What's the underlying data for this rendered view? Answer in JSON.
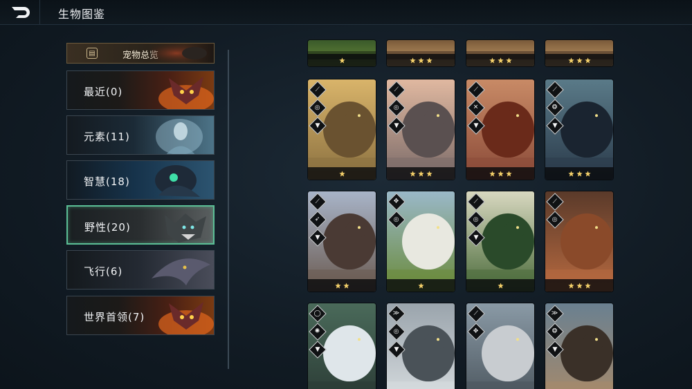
{
  "header": {
    "title": "生物图鉴",
    "back_icon": "back-arrow-icon"
  },
  "overview": {
    "label": "宠物总览",
    "icon": "book-icon"
  },
  "categories": [
    {
      "label": "最近(0)",
      "selected": false,
      "art": "fire-demon"
    },
    {
      "label": "元素(11)",
      "selected": false,
      "art": "ice-spirit"
    },
    {
      "label": "智慧(18)",
      "selected": false,
      "art": "goblin-mage"
    },
    {
      "label": "野性(20)",
      "selected": true,
      "art": "wolf-beast"
    },
    {
      "label": "飞行(6)",
      "selected": false,
      "art": "wyvern"
    },
    {
      "label": "世界首领(7)",
      "selected": false,
      "art": "fire-demon"
    }
  ],
  "colors": {
    "selected_border": "#5bbf96",
    "star": "#f4d06a",
    "badge_border": "#d6d8da"
  },
  "cards": [
    {
      "row": 0,
      "stars": 1,
      "partial": true,
      "creature": "forest-scene"
    },
    {
      "row": 0,
      "stars": 3,
      "partial": true,
      "creature": "desert-scene"
    },
    {
      "row": 0,
      "stars": 3,
      "partial": true,
      "creature": "desert-scene"
    },
    {
      "row": 0,
      "stars": 3,
      "partial": true,
      "creature": "desert-scene"
    },
    {
      "row": 1,
      "stars": 1,
      "creature": "golden-hyena",
      "badges": [
        "claw",
        "swirl",
        "fang"
      ]
    },
    {
      "row": 1,
      "stars": 3,
      "creature": "stone-dinosaur",
      "badges": [
        "claw",
        "swirl",
        "fang"
      ]
    },
    {
      "row": 1,
      "stars": 3,
      "creature": "lava-beast",
      "badges": [
        "claw",
        "hammer",
        "fang"
      ]
    },
    {
      "row": 1,
      "stars": 3,
      "creature": "shadow-panther",
      "badges": [
        "claw",
        "spiral",
        "fang"
      ]
    },
    {
      "row": 2,
      "stars": 2,
      "creature": "spiked-boar",
      "badges": [
        "claw",
        "arrow",
        "fang"
      ]
    },
    {
      "row": 2,
      "stars": 1,
      "creature": "sheep",
      "badges": [
        "paw",
        "swirl"
      ]
    },
    {
      "row": 2,
      "stars": 1,
      "creature": "thorn-beetle",
      "badges": [
        "claw",
        "swirl",
        "fang"
      ]
    },
    {
      "row": 2,
      "stars": 3,
      "creature": "armored-crab",
      "badges": [
        "claw",
        "swirl"
      ]
    },
    {
      "row": 3,
      "stars": 0,
      "creature": "unicorn",
      "badges": [
        "ring",
        "target",
        "fang"
      ]
    },
    {
      "row": 3,
      "stars": 0,
      "creature": "white-wolf",
      "badges": [
        "wing",
        "swirl",
        "fang"
      ]
    },
    {
      "row": 3,
      "stars": 0,
      "creature": "yeti",
      "badges": [
        "claw",
        "paw"
      ]
    },
    {
      "row": 3,
      "stars": 0,
      "creature": "skeletal-horse",
      "badges": [
        "wing",
        "spiral",
        "fang"
      ]
    }
  ]
}
